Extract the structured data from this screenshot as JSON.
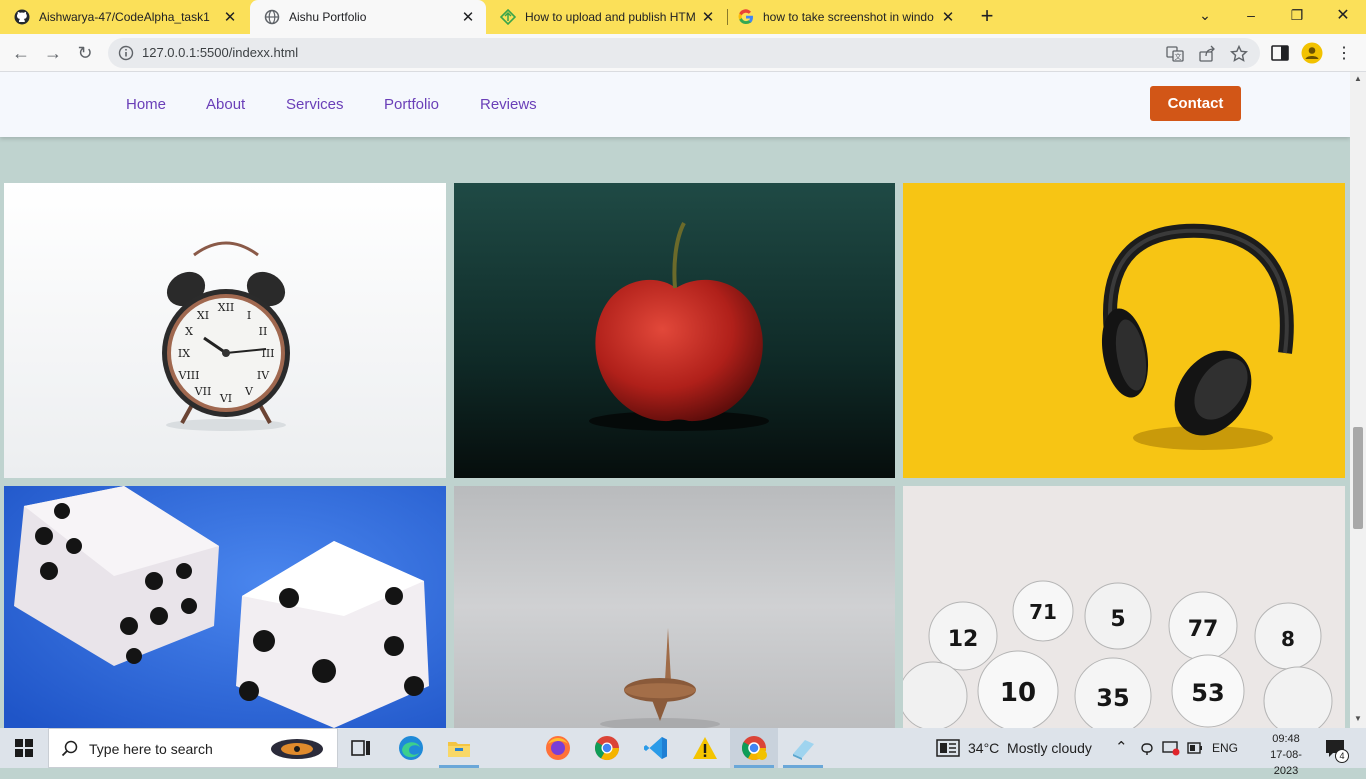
{
  "browser": {
    "tabs": [
      {
        "title": "Aishwarya-47/CodeAlpha_task1",
        "icon": "github-icon"
      },
      {
        "title": "Aishu Portfolio",
        "icon": "globe-icon"
      },
      {
        "title": "How to upload and publish HTM",
        "icon": "upload-site-icon"
      },
      {
        "title": "how to take screenshot in windo",
        "icon": "google-icon"
      }
    ],
    "url": "127.0.0.1:5500/indexx.html"
  },
  "site": {
    "nav": {
      "links": [
        "Home",
        "About",
        "Services",
        "Portfolio",
        "Reviews"
      ],
      "contact": "Contact"
    },
    "gallery": [
      {
        "subject": "alarm-clock"
      },
      {
        "subject": "red-apple"
      },
      {
        "subject": "headphones"
      },
      {
        "subject": "dice"
      },
      {
        "subject": "spinning-top"
      },
      {
        "subject": "lottery-balls"
      }
    ],
    "colors": {
      "nav_link": "#6a3fb8",
      "contact_bg": "#d25617",
      "page_bg": "#bfd3cf"
    }
  },
  "taskbar": {
    "search_placeholder": "Type here to search",
    "weather": "34°C  Mostly cloudy",
    "language": "ENG",
    "time": "09:48",
    "date": "17-08-2023",
    "notifications": "4"
  }
}
